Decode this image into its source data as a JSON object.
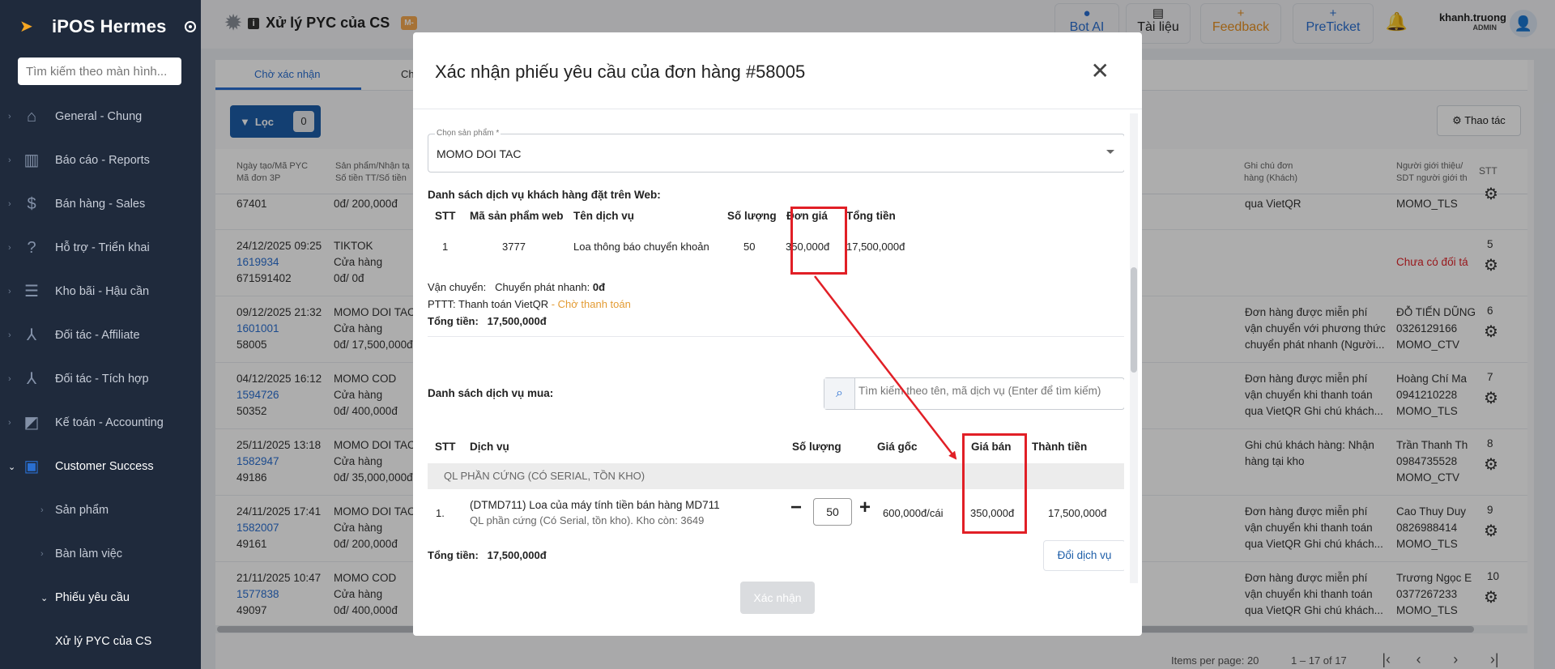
{
  "sidebar": {
    "app_name": "iPOS Hermes",
    "search_placeholder": "Tìm kiếm theo màn hình...",
    "items": [
      {
        "label": "General - Chung",
        "icon": "home-icon"
      },
      {
        "label": "Báo cáo - Reports",
        "icon": "chart-icon"
      },
      {
        "label": "Bán hàng - Sales",
        "icon": "dollar-icon"
      },
      {
        "label": "Hỗ trợ - Triển khai",
        "icon": "help-icon"
      },
      {
        "label": "Kho bãi - Hậu cần",
        "icon": "list-icon"
      },
      {
        "label": "Đối tác - Affiliate",
        "icon": "network-icon"
      },
      {
        "label": "Đối tác - Tích hợp",
        "icon": "network-icon"
      },
      {
        "label": "Kế toán - Accounting",
        "icon": "ledger-icon"
      },
      {
        "label": "Customer Success",
        "icon": "person-card-icon"
      }
    ],
    "sub_items": [
      "Sản phẩm",
      "Bàn làm việc",
      "Phiếu yêu cầu",
      "Xử lý PYC của CS"
    ]
  },
  "topbar": {
    "page_title": "Xử lý PYC của CS",
    "badge": "M-",
    "bot_label": "Bot AI",
    "docs_label": "Tài liệu",
    "feedback_label": "Feedback",
    "preticket_label": "PreTicket",
    "username": "khanh.truong",
    "role": "ADMIN"
  },
  "background": {
    "tabs": [
      "Chờ xác nhận",
      "Ch"
    ],
    "filter_label": "Lọc",
    "filter_count": "0",
    "action_label": "Thao tác",
    "headers": {
      "created": "Ngày tạo/Mã PYC\nMã đơn 3P",
      "product": "Sản phẩm/Nhận tạ\nSố tiền TT/Số tiền",
      "note": "Ghi chú đơn\nhàng (Khách)",
      "referrer": "Người giới thiệu/\nSDT người giới th",
      "stt": "STT"
    },
    "rows": [
      {
        "d1": "",
        "d2": "",
        "d3": "67401",
        "p1": "",
        "p2": "",
        "p3": "0đ/ 200,000đ",
        "n1": "qua VietQR",
        "n2": "",
        "n3": "",
        "r1": "MOMO_TLS",
        "r2": "",
        "r3": "",
        "stt": ""
      },
      {
        "d1": "24/12/2025 09:25",
        "d2": "1619934",
        "d3": "671591402",
        "p1": "TIKTOK",
        "p2": "Cửa hàng",
        "p3": "0đ/ 0đ",
        "n1": "",
        "n2": "",
        "n3": "",
        "r1": "",
        "r2": "Chưa có đối tá",
        "r3": "",
        "stt": "5"
      },
      {
        "d1": "09/12/2025 21:32",
        "d2": "1601001",
        "d3": "58005",
        "p1": "MOMO DOI TAC",
        "p2": "Cửa hàng",
        "p3": "0đ/ 17,500,000đ",
        "n1": "Đơn hàng được miễn phí",
        "n2": "vận chuyển với phương thức",
        "n3": "chuyển phát nhanh (Người...",
        "r1": "ĐỖ TIẾN DŨNG",
        "r2": "0326129166",
        "r3": "MOMO_CTV",
        "stt": "6"
      },
      {
        "d1": "04/12/2025 16:12",
        "d2": "1594726",
        "d3": "50352",
        "p1": "MOMO COD",
        "p2": "Cửa hàng",
        "p3": "0đ/ 400,000đ",
        "n1": "Đơn hàng được miễn phí",
        "n2": "vận chuyển khi thanh toán",
        "n3": "qua VietQR Ghi chú khách...",
        "r1": "Hoàng Chí Ma",
        "r2": "0941210228",
        "r3": "MOMO_TLS",
        "stt": "7"
      },
      {
        "d1": "25/11/2025 13:18",
        "d2": "1582947",
        "d3": "49186",
        "p1": "MOMO DOI TAC",
        "p2": "Cửa hàng",
        "p3": "0đ/ 35,000,000đ",
        "n1": "Ghi chú khách hàng: Nhận",
        "n2": "hàng tại kho",
        "n3": "",
        "r1": "Trần Thanh Th",
        "r2": "0984735528",
        "r3": "MOMO_CTV",
        "stt": "8"
      },
      {
        "d1": "24/11/2025 17:41",
        "d2": "1582007",
        "d3": "49161",
        "p1": "MOMO DOI TAC",
        "p2": "Cửa hàng",
        "p3": "0đ/ 200,000đ",
        "n1": "Đơn hàng được miễn phí",
        "n2": "vận chuyển khi thanh toán",
        "n3": "qua VietQR Ghi chú khách...",
        "r1": "Cao Thuy Duy",
        "r2": "0826988414",
        "r3": "MOMO_TLS",
        "stt": "9"
      },
      {
        "d1": "21/11/2025 10:47",
        "d2": "1577838",
        "d3": "49097",
        "p1": "MOMO COD",
        "p2": "Cửa hàng",
        "p3": "0đ/ 400,000đ",
        "n1": "Đơn hàng được miễn phí",
        "n2": "vận chuyển khi thanh toán",
        "n3": "qua VietQR Ghi chú khách...",
        "r1": "Trương Ngọc E",
        "r2": "0377267233",
        "r3": "MOMO_TLS",
        "stt": "10"
      }
    ],
    "pager": {
      "items_per_page": "Items per page: 20",
      "range": "1 – 17 of 17"
    }
  },
  "modal": {
    "title": "Xác nhận phiếu yêu cầu của đơn hàng #58005",
    "product_select": {
      "label": "Chọn sản phẩm *",
      "value": "MOMO DOI TAC"
    },
    "web_section": {
      "title": "Danh sách dịch vụ khách hàng đặt trên Web:",
      "headers": {
        "stt": "STT",
        "code": "Mã sản phẩm web",
        "name": "Tên dịch vụ",
        "qty": "Số lượng",
        "price": "Đơn giá",
        "total": "Tổng tiền"
      },
      "row": {
        "stt": "1",
        "code": "3777",
        "name": "Loa thông báo chuyển khoản",
        "qty": "50",
        "price": "350,000đ",
        "total": "17,500,000đ"
      }
    },
    "shipping": {
      "label": "Vận chuyển:",
      "method": "Chuyển phát nhanh:",
      "fee": "0đ"
    },
    "payment": {
      "label": "PTTT: Thanh toán VietQR",
      "status": " - Chờ thanh toán"
    },
    "total1": {
      "label": "Tổng tiền:",
      "value": "17,500,000đ"
    },
    "buy_section": {
      "title": "Danh sách dịch vụ mua:",
      "search_placeholder": "Tìm kiếm theo tên, mã dịch vụ (Enter để tìm kiếm)",
      "headers": {
        "stt": "STT",
        "service": "Dịch vụ",
        "qty": "Số lượng",
        "base_price": "Giá gốc",
        "sell_price": "Giá bán",
        "amount": "Thành tiền"
      },
      "group": "QL PHẦN CỨNG (CÓ SERIAL, TỒN KHO)",
      "row": {
        "stt": "1.",
        "name": "(DTMD711) Loa của máy tính tiền bán hàng MD711",
        "sub": "QL phần cứng (Có Serial, tồn kho). Kho còn: 3649",
        "minus": "−",
        "qty": "50",
        "plus": "+",
        "base_price": "600,000đ/cái",
        "sell_price": "350,000đ",
        "amount": "17,500,000đ"
      }
    },
    "total2": {
      "label": "Tổng tiền:",
      "value": "17,500,000đ"
    },
    "change_button": "Đổi dịch vụ",
    "confirm_button": "Xác nhận",
    "close_symbol": "✕"
  },
  "annotation_color": "#e11f26"
}
